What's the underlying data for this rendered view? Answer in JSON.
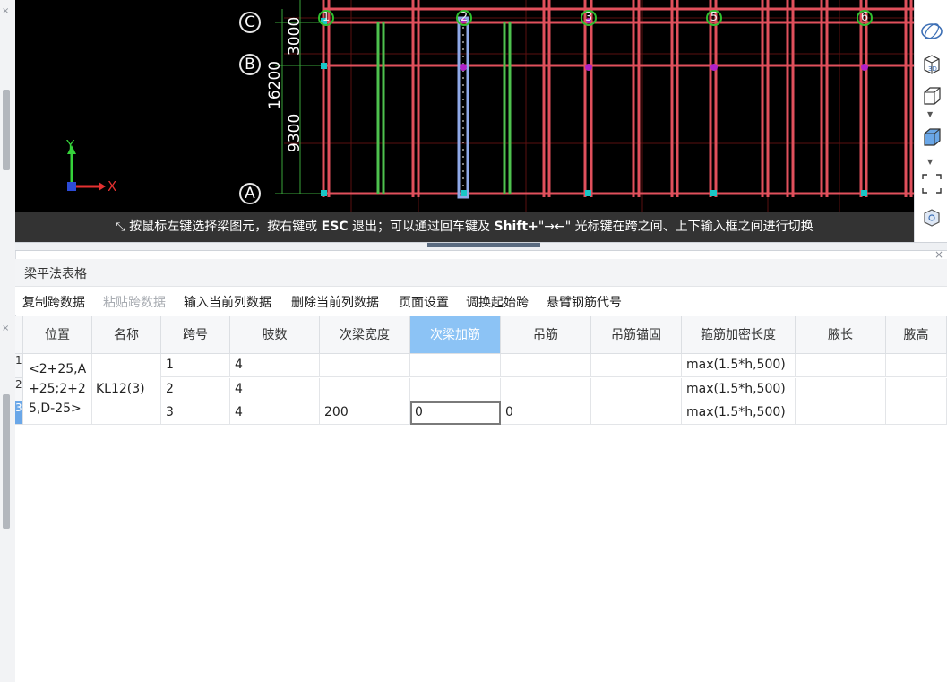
{
  "viewport": {
    "axis_rows": [
      "C",
      "B",
      "A"
    ],
    "axis_columns": [
      "1",
      "2",
      "3",
      "5",
      "6"
    ],
    "dimensions": [
      "3000",
      "16200",
      "9300"
    ],
    "coordinate_labels": {
      "y": "Y",
      "x": "X"
    },
    "hint_text_before": "按鼠标左键选择梁图元，按右键或",
    "hint_esc": "ESC",
    "hint_text_middle": "退出；可以通过回车键及",
    "hint_shift": "Shift+",
    "hint_text_after": "\"→←\" 光标键在跨之间、上下输入框之间进行切换",
    "colors": {
      "beam": "#e0505c",
      "beam_green": "#4ec24e",
      "selected_beam": "#8fa9e8",
      "background": "#000000"
    }
  },
  "right_toolbar": {
    "icons": [
      "orbit-icon",
      "view-3d-icon",
      "box-view-icon",
      "box-view-filled-icon",
      "zoom-extent-icon",
      "settings-cube-icon"
    ]
  },
  "panel": {
    "title": "梁平法表格",
    "toolbar": [
      {
        "label": "复制跨数据",
        "enabled": true
      },
      {
        "label": "粘贴跨数据",
        "enabled": false
      },
      {
        "label": "输入当前列数据",
        "enabled": true
      },
      {
        "label": "删除当前列数据",
        "enabled": true
      },
      {
        "label": "页面设置",
        "enabled": true
      },
      {
        "label": "调换起始跨",
        "enabled": true
      },
      {
        "label": "悬臂钢筋代号",
        "enabled": true
      }
    ],
    "table": {
      "headers": [
        "位置",
        "名称",
        "跨号",
        "肢数",
        "次梁宽度",
        "次梁加筋",
        "吊筋",
        "吊筋锚固",
        "箍筋加密长度",
        "腋长",
        "腋高"
      ],
      "active_header": "次梁加筋",
      "row_numbers": [
        "1",
        "2",
        "3"
      ],
      "position_lines": [
        "<2+25,A",
        "+25;2+2",
        "5,D-25>"
      ],
      "name": "KL12(3)",
      "rows": [
        {
          "span": "1",
          "legs": "4",
          "sec_width": "",
          "sec_rebar": "",
          "hanger": "",
          "hanger_anchor": "",
          "dense_len": "max(1.5*h,500)",
          "haunch_len": "",
          "haunch_h": ""
        },
        {
          "span": "2",
          "legs": "4",
          "sec_width": "",
          "sec_rebar": "",
          "hanger": "",
          "hanger_anchor": "",
          "dense_len": "max(1.5*h,500)",
          "haunch_len": "",
          "haunch_h": ""
        },
        {
          "span": "3",
          "legs": "4",
          "sec_width": "200",
          "sec_rebar": "0",
          "hanger": "0",
          "hanger_anchor": "",
          "dense_len": "max(1.5*h,500)",
          "haunch_len": "",
          "haunch_h": ""
        }
      ]
    }
  }
}
